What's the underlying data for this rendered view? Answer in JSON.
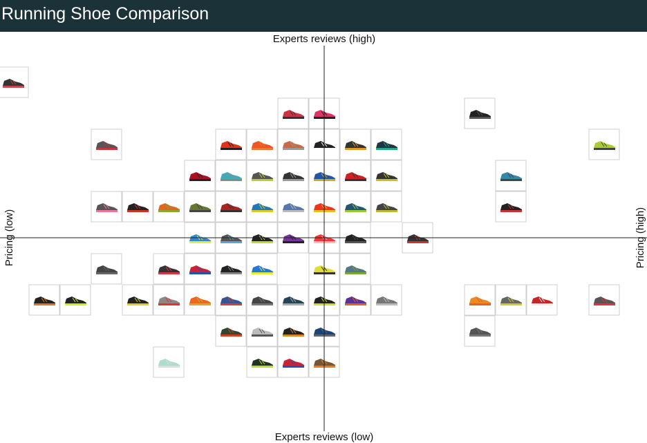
{
  "header": {
    "title": "Running Shoe Comparison"
  },
  "colors": {
    "header_bg": "#1b3238",
    "title_text": "#ffffff",
    "axis": "#222222",
    "tile_border": "#cfcfcf"
  },
  "axes": {
    "top_label": "Experts reviews (high)",
    "bottom_label": "Experts reviews (low)",
    "left_label": "Pricing (low)",
    "right_label": "Pricing (high)"
  },
  "chart_data": {
    "type": "scatter",
    "x_axis": {
      "label_low": "Pricing (low)",
      "label_high": "Pricing (high)",
      "range": [
        -10,
        10
      ]
    },
    "y_axis": {
      "label_low": "Experts reviews (low)",
      "label_high": "Experts reviews (high)",
      "range": [
        -5,
        5
      ]
    },
    "grid": false,
    "points": [
      {
        "x": -10,
        "y": 5,
        "upper": "#333",
        "sole": "#cc4444"
      },
      {
        "x": -1,
        "y": 4,
        "upper": "#cc3344",
        "sole": "#333"
      },
      {
        "x": 0,
        "y": 4,
        "upper": "#dd3366",
        "sole": "#222"
      },
      {
        "x": 5,
        "y": 4,
        "upper": "#222",
        "sole": "#555"
      },
      {
        "x": -7,
        "y": 3,
        "upper": "#555",
        "sole": "#cc3333"
      },
      {
        "x": -3,
        "y": 3,
        "upper": "#dd3322",
        "sole": "#222"
      },
      {
        "x": -2,
        "y": 3,
        "upper": "#ee5522",
        "sole": "#ee7733"
      },
      {
        "x": -1,
        "y": 3,
        "upper": "#cc6644",
        "sole": "#999"
      },
      {
        "x": 0,
        "y": 3,
        "upper": "#222",
        "sole": "#fff"
      },
      {
        "x": 1,
        "y": 3,
        "upper": "#333",
        "sole": "#dd9922"
      },
      {
        "x": 2,
        "y": 3,
        "upper": "#223344",
        "sole": "#22aa88"
      },
      {
        "x": 9,
        "y": 3,
        "upper": "#aacc33",
        "sole": "#444"
      },
      {
        "x": -4,
        "y": 2,
        "upper": "#aa1122",
        "sole": "#222"
      },
      {
        "x": -3,
        "y": 2,
        "upper": "#44aabb",
        "sole": "#888"
      },
      {
        "x": -2,
        "y": 2,
        "upper": "#555",
        "sole": "#bbcc33"
      },
      {
        "x": -1,
        "y": 2,
        "upper": "#333",
        "sole": "#999"
      },
      {
        "x": 0,
        "y": 2,
        "upper": "#2255aa",
        "sole": "#ccaa22"
      },
      {
        "x": 1,
        "y": 2,
        "upper": "#cc2222",
        "sole": "#333"
      },
      {
        "x": 2,
        "y": 2,
        "upper": "#333",
        "sole": "#ccbb22"
      },
      {
        "x": 6,
        "y": 2,
        "upper": "#3388aa",
        "sole": "#444"
      },
      {
        "x": -7,
        "y": 1,
        "upper": "#555",
        "sole": "#ee7799"
      },
      {
        "x": -6,
        "y": 1,
        "upper": "#222",
        "sole": "#cc3322"
      },
      {
        "x": -5,
        "y": 1,
        "upper": "#dd6622",
        "sole": "#88aa33"
      },
      {
        "x": -4,
        "y": 1,
        "upper": "#667733",
        "sole": "#444"
      },
      {
        "x": -3,
        "y": 1,
        "upper": "#aa2222",
        "sole": "#333"
      },
      {
        "x": -2,
        "y": 1,
        "upper": "#2277bb",
        "sole": "#ddcc22"
      },
      {
        "x": -1,
        "y": 1,
        "upper": "#5577aa",
        "sole": "#bbbbbb"
      },
      {
        "x": 0,
        "y": 1,
        "upper": "#ee3322",
        "sole": "#eebb22"
      },
      {
        "x": 1,
        "y": 1,
        "upper": "#225577",
        "sole": "#99cc33"
      },
      {
        "x": 2,
        "y": 1,
        "upper": "#444",
        "sole": "#bbbb33"
      },
      {
        "x": 6,
        "y": 1,
        "upper": "#222",
        "sole": "#cc3333"
      },
      {
        "x": -4,
        "y": 0,
        "upper": "#3388cc",
        "sole": "#ddee44"
      },
      {
        "x": -3,
        "y": 0,
        "upper": "#555",
        "sole": "#55aacc"
      },
      {
        "x": -2,
        "y": 0,
        "upper": "#222",
        "sole": "#bbdd33"
      },
      {
        "x": -1,
        "y": 0,
        "upper": "#773399",
        "sole": "#222"
      },
      {
        "x": 0,
        "y": 0,
        "upper": "#ff3333",
        "sole": "#ffbbbb"
      },
      {
        "x": 1,
        "y": 0,
        "upper": "#222",
        "sole": "#555"
      },
      {
        "x": 3,
        "y": 0,
        "upper": "#333",
        "sole": "#cc3333"
      },
      {
        "x": -7,
        "y": -1,
        "upper": "#444",
        "sole": "#666"
      },
      {
        "x": -5,
        "y": -1,
        "upper": "#333",
        "sole": "#dd3344"
      },
      {
        "x": -4,
        "y": -1,
        "upper": "#cc2233",
        "sole": "#2255aa"
      },
      {
        "x": -3,
        "y": -1,
        "upper": "#222",
        "sole": "#888"
      },
      {
        "x": -2,
        "y": -1,
        "upper": "#2277dd",
        "sole": "#ddee33"
      },
      {
        "x": 0,
        "y": -1,
        "upper": "#dddd33",
        "sole": "#333"
      },
      {
        "x": 1,
        "y": -1,
        "upper": "#557788",
        "sole": "#77aa33"
      },
      {
        "x": -9,
        "y": -2,
        "upper": "#222",
        "sole": "#dd7722"
      },
      {
        "x": -8,
        "y": -2,
        "upper": "#222",
        "sole": "#ccee22"
      },
      {
        "x": -6,
        "y": -2,
        "upper": "#222",
        "sole": "#ddcc33"
      },
      {
        "x": -5,
        "y": -2,
        "upper": "#888",
        "sole": "#dd3333"
      },
      {
        "x": -4,
        "y": -2,
        "upper": "#ee6622",
        "sole": "#ccaa33"
      },
      {
        "x": -3,
        "y": -2,
        "upper": "#335599",
        "sole": "#cc4433"
      },
      {
        "x": -2,
        "y": -2,
        "upper": "#444",
        "sole": "#777"
      },
      {
        "x": -1,
        "y": -2,
        "upper": "#224455",
        "sole": "#aaaaaa"
      },
      {
        "x": 0,
        "y": -2,
        "upper": "#222",
        "sole": "#ccdd33"
      },
      {
        "x": 1,
        "y": -2,
        "upper": "#553399",
        "sole": "#dd6622"
      },
      {
        "x": 2,
        "y": -2,
        "upper": "#777",
        "sole": "#bbbbbb"
      },
      {
        "x": 5,
        "y": -2,
        "upper": "#ee8822",
        "sole": "#dd6622"
      },
      {
        "x": 6,
        "y": -2,
        "upper": "#666",
        "sole": "#cccc33"
      },
      {
        "x": 7,
        "y": -2,
        "upper": "#cc2222",
        "sole": "#eeeeee"
      },
      {
        "x": 9,
        "y": -2,
        "upper": "#555",
        "sole": "#dd3344"
      },
      {
        "x": -3,
        "y": -3,
        "upper": "#334433",
        "sole": "#cc4422"
      },
      {
        "x": -2,
        "y": -3,
        "upper": "#bbbbbb",
        "sole": "#555"
      },
      {
        "x": -1,
        "y": -3,
        "upper": "#222",
        "sole": "#dd8822"
      },
      {
        "x": 0,
        "y": -3,
        "upper": "#1d4477",
        "sole": "#666"
      },
      {
        "x": 5,
        "y": -3,
        "upper": "#555",
        "sole": "#777"
      },
      {
        "x": -5,
        "y": -4,
        "upper": "#aaddcc",
        "sole": "#dddddd"
      },
      {
        "x": -2,
        "y": -4,
        "upper": "#223322",
        "sole": "#bbdd33"
      },
      {
        "x": -1,
        "y": -4,
        "upper": "#cc2233",
        "sole": "#2255aa"
      },
      {
        "x": 0,
        "y": -4,
        "upper": "#775533",
        "sole": "#ee7722"
      }
    ]
  }
}
